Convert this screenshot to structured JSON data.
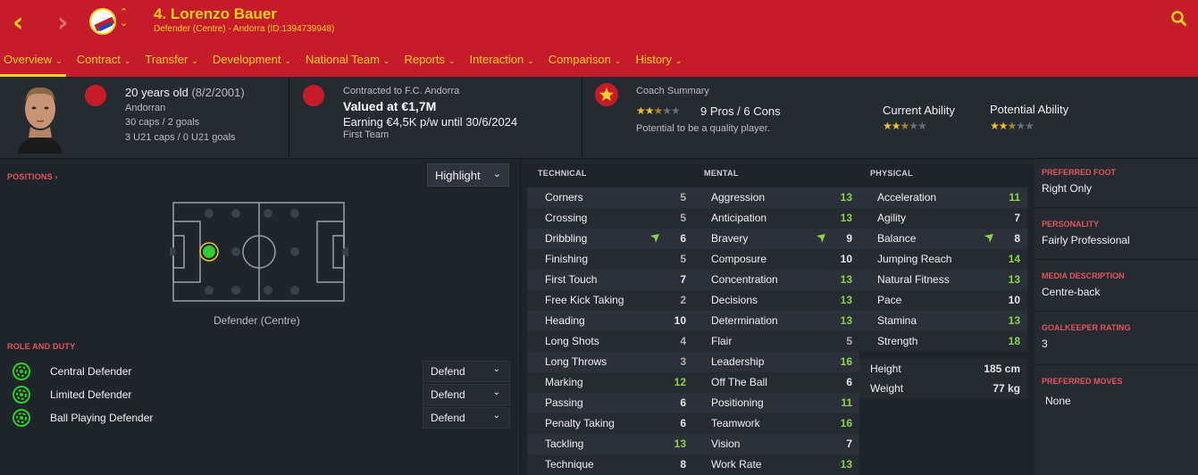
{
  "header": {
    "back_label": "‹",
    "forward_label": "›",
    "switch_label": "⌃⌄",
    "title": "4. Lorenzo Bauer",
    "subtitle": "Defender (Centre) - Andorra (ID:1394739948)"
  },
  "tabs": [
    {
      "label": "Overview"
    },
    {
      "label": "Contract"
    },
    {
      "label": "Transfer"
    },
    {
      "label": "Development"
    },
    {
      "label": "National Team"
    },
    {
      "label": "Reports"
    },
    {
      "label": "Interaction"
    },
    {
      "label": "Comparison"
    },
    {
      "label": "History"
    }
  ],
  "tab_chevron": "⌄",
  "profile": {
    "age": "20 years old",
    "dob": "(8/2/2001)",
    "nationality": "Andorran",
    "caps": "30 caps / 2 goals",
    "u21_caps": "3 U21 caps / 0 U21 goals"
  },
  "contract": {
    "club": "Contracted to F.C. Andorra",
    "value": "Valued at €1,7M",
    "earning": "Earning €4,5K p/w until 30/6/2024",
    "squad": "First Team"
  },
  "coach": {
    "title": "Coach Summary",
    "stars": 2.5,
    "pros_cons": "9 Pros / 6 Cons",
    "summary": "Potential to be a quality player.",
    "current_label": "Current Ability",
    "current_stars": 2.5,
    "potential_label": "Potential Ability",
    "potential_stars": 2.5
  },
  "positions": {
    "label": "POSITIONS",
    "arrow": "›",
    "highlight": "Highlight",
    "chevron": "⌄",
    "position_name": "Defender (Centre)"
  },
  "roles": {
    "label": "ROLE AND DUTY",
    "items": [
      {
        "name": "Central Defender",
        "duty": "Defend"
      },
      {
        "name": "Limited Defender",
        "duty": "Defend"
      },
      {
        "name": "Ball Playing Defender",
        "duty": "Defend"
      }
    ]
  },
  "technical": {
    "header": "TECHNICAL",
    "items": [
      {
        "name": "Corners",
        "value": "5",
        "trend": false
      },
      {
        "name": "Crossing",
        "value": "5",
        "trend": false
      },
      {
        "name": "Dribbling",
        "value": "6",
        "trend": true
      },
      {
        "name": "Finishing",
        "value": "5",
        "trend": false
      },
      {
        "name": "First Touch",
        "value": "7",
        "trend": false
      },
      {
        "name": "Free Kick Taking",
        "value": "2",
        "trend": false
      },
      {
        "name": "Heading",
        "value": "10",
        "trend": false
      },
      {
        "name": "Long Shots",
        "value": "4",
        "trend": false
      },
      {
        "name": "Long Throws",
        "value": "3",
        "trend": false
      },
      {
        "name": "Marking",
        "value": "12",
        "trend": false
      },
      {
        "name": "Passing",
        "value": "6",
        "trend": false
      },
      {
        "name": "Penalty Taking",
        "value": "6",
        "trend": false
      },
      {
        "name": "Tackling",
        "value": "13",
        "trend": false
      },
      {
        "name": "Technique",
        "value": "8",
        "trend": false
      }
    ]
  },
  "mental": {
    "header": "MENTAL",
    "items": [
      {
        "name": "Aggression",
        "value": "13",
        "trend": false
      },
      {
        "name": "Anticipation",
        "value": "13",
        "trend": false
      },
      {
        "name": "Bravery",
        "value": "9",
        "trend": true
      },
      {
        "name": "Composure",
        "value": "10",
        "trend": false
      },
      {
        "name": "Concentration",
        "value": "13",
        "trend": false
      },
      {
        "name": "Decisions",
        "value": "13",
        "trend": false
      },
      {
        "name": "Determination",
        "value": "13",
        "trend": false
      },
      {
        "name": "Flair",
        "value": "5",
        "trend": false
      },
      {
        "name": "Leadership",
        "value": "16",
        "trend": false
      },
      {
        "name": "Off The Ball",
        "value": "6",
        "trend": false
      },
      {
        "name": "Positioning",
        "value": "11",
        "trend": false
      },
      {
        "name": "Teamwork",
        "value": "16",
        "trend": false
      },
      {
        "name": "Vision",
        "value": "7",
        "trend": false
      },
      {
        "name": "Work Rate",
        "value": "13",
        "trend": false
      }
    ]
  },
  "physical": {
    "header": "PHYSICAL",
    "items": [
      {
        "name": "Acceleration",
        "value": "11",
        "trend": false
      },
      {
        "name": "Agility",
        "value": "7",
        "trend": false
      },
      {
        "name": "Balance",
        "value": "8",
        "trend": true
      },
      {
        "name": "Jumping Reach",
        "value": "14",
        "trend": false
      },
      {
        "name": "Natural Fitness",
        "value": "13",
        "trend": false
      },
      {
        "name": "Pace",
        "value": "10",
        "trend": false
      },
      {
        "name": "Stamina",
        "value": "13",
        "trend": false
      },
      {
        "name": "Strength",
        "value": "18",
        "trend": false
      }
    ],
    "height_label": "Height",
    "height": "185 cm",
    "weight_label": "Weight",
    "weight": "77 kg"
  },
  "details": {
    "foot_label": "PREFERRED FOOT",
    "foot": "Right Only",
    "personality_label": "PERSONALITY",
    "personality": "Fairly Professional",
    "media_label": "MEDIA DESCRIPTION",
    "media": "Centre-back",
    "gk_label": "GOALKEEPER RATING",
    "gk": "3",
    "moves_label": "PREFERRED MOVES",
    "moves": "None"
  },
  "colors": {
    "brand_red": "#c61c2a",
    "accent_yellow": "#f4d21e",
    "attr_high": "#8fd14f"
  }
}
